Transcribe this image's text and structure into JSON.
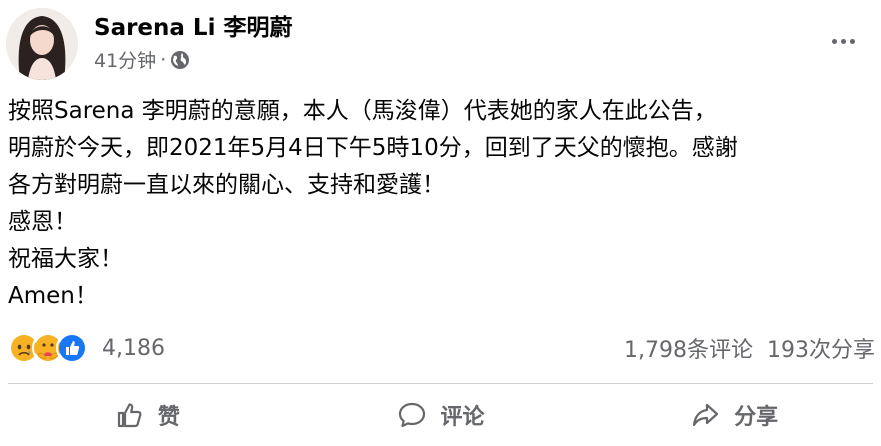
{
  "post": {
    "author": "Sarena Li 李明蔚",
    "time": "41分钟",
    "separator": "·",
    "privacy_icon": "globe-icon",
    "body_lines": [
      "按照Sarena 李明蔚的意願，本人（馬浚偉）代表她的家人在此公告，",
      "明蔚於今天，即2021年5月4日下午5時10分，回到了天父的懷抱。感謝",
      "各方對明蔚一直以來的關心、支持和愛護！",
      "感恩！",
      "祝福大家！",
      "Amen！"
    ]
  },
  "reactions": {
    "icons": [
      "sad-icon",
      "care-icon",
      "like-icon"
    ],
    "count": "4,186"
  },
  "stats": {
    "comments": "1,798条评论",
    "shares": "193次分享"
  },
  "actions": {
    "like": "赞",
    "comment": "评论",
    "share": "分享"
  },
  "colors": {
    "secondary_text": "#65676b",
    "like_blue": "#1877f2",
    "reaction_yellow": "#f7b125"
  }
}
